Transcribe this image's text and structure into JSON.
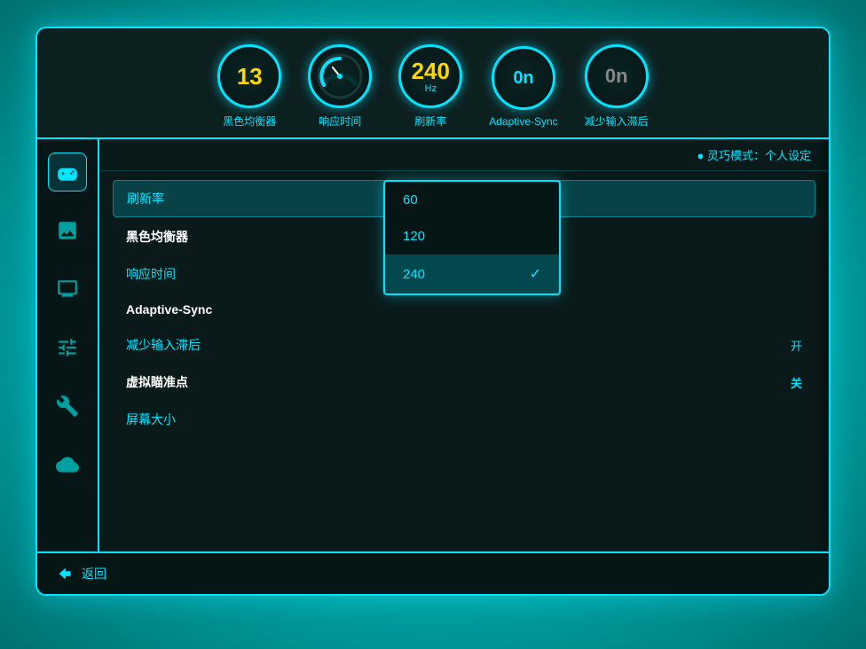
{
  "background": "#00b8b8",
  "header": {
    "stats": [
      {
        "id": "black-equalizer",
        "value": "13",
        "unit": "",
        "label": "黑色均衡器",
        "style": "yellow"
      },
      {
        "id": "response-time",
        "value": "",
        "unit": "",
        "label": "响应时间",
        "style": "speedometer"
      },
      {
        "id": "refresh-rate",
        "value": "240",
        "unit": "Hz",
        "label": "刷新率",
        "style": "yellow"
      },
      {
        "id": "adaptive-sync",
        "value": "0n",
        "unit": "",
        "label": "Adaptive-Sync",
        "style": "cyan"
      },
      {
        "id": "input-lag",
        "value": "0n",
        "unit": "",
        "label": "减少输入滞后",
        "style": "gray"
      }
    ]
  },
  "sidebar": {
    "icons": [
      {
        "id": "gamepad",
        "symbol": "🎮",
        "active": true
      },
      {
        "id": "image",
        "symbol": "🖼",
        "active": false
      },
      {
        "id": "display",
        "symbol": "🖥",
        "active": false
      },
      {
        "id": "settings",
        "symbol": "⚙",
        "active": false
      },
      {
        "id": "tools",
        "symbol": "🔧",
        "active": false
      },
      {
        "id": "cloud",
        "symbol": "☁",
        "active": false
      }
    ]
  },
  "smart_mode": {
    "prefix": "●",
    "label": "灵巧模式：个人设定"
  },
  "menu": {
    "items": [
      {
        "id": "refresh-rate",
        "label": "刷新率",
        "value": "",
        "bold": false,
        "selected": true
      },
      {
        "id": "black-equalizer",
        "label": "黑色均衡器",
        "value": "",
        "bold": true,
        "selected": false
      },
      {
        "id": "response-time",
        "label": "响应时间",
        "value": "",
        "bold": false,
        "selected": false
      },
      {
        "id": "adaptive-sync",
        "label": "Adaptive-Sync",
        "value": "",
        "bold": true,
        "selected": false
      },
      {
        "id": "input-lag-reduce",
        "label": "减少输入滞后",
        "value": "开",
        "bold": false,
        "selected": false
      },
      {
        "id": "virtual-aim",
        "label": "虚拟瞄准点",
        "value": "关",
        "bold": true,
        "selected": false
      },
      {
        "id": "screen-size",
        "label": "屏幕大小",
        "value": "",
        "bold": false,
        "selected": false
      }
    ]
  },
  "dropdown": {
    "options": [
      {
        "id": "opt-60",
        "label": "60",
        "selected": false
      },
      {
        "id": "opt-120",
        "label": "120",
        "selected": false
      },
      {
        "id": "opt-240",
        "label": "240",
        "selected": true
      }
    ]
  },
  "footer": {
    "back_label": "返回"
  }
}
